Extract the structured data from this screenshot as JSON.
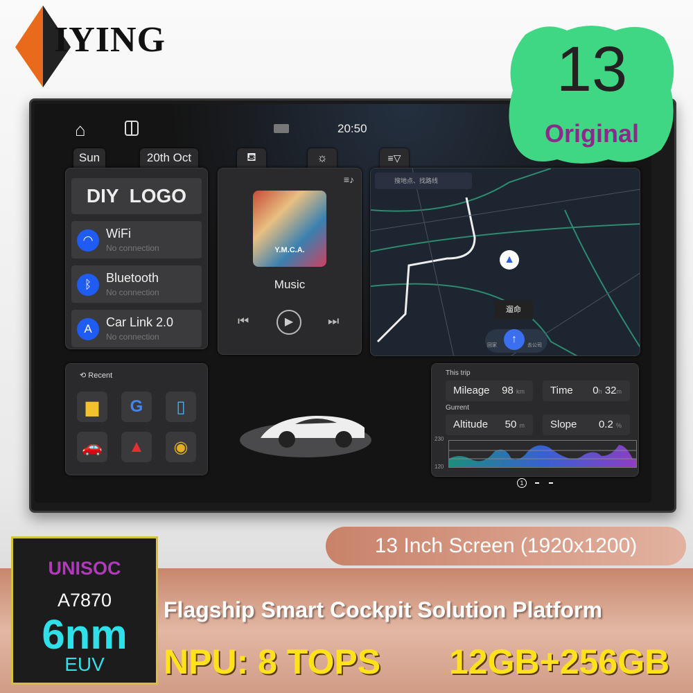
{
  "brand": {
    "name": "IYING",
    "registered": "®"
  },
  "badge": {
    "version": "13",
    "label": "Original",
    "color": "#3fd784"
  },
  "statusbar": {
    "time": "20:50",
    "icons": [
      "home-icon",
      "split-screen-icon",
      "camera-icon"
    ]
  },
  "chips": {
    "day": "Sun",
    "date": "20th Oct",
    "icons": [
      "seat-icon",
      "light-bulb-icon",
      "menu-filter-icon"
    ]
  },
  "connectivity": {
    "logo": "DIY  LOGO",
    "items": [
      {
        "title": "WiFi",
        "status": "No connection",
        "icon": "wifi-icon"
      },
      {
        "title": "Bluetooth",
        "status": "No connection",
        "icon": "bluetooth-icon"
      },
      {
        "title": "Car Link 2.0",
        "status": "No connection",
        "icon": "car-link-icon"
      }
    ]
  },
  "music": {
    "title": "Music",
    "album_text": "Y.M.C.A."
  },
  "map": {
    "search_placeholder": "搜地点、找路线",
    "center_label": "遛命",
    "home": "回家",
    "company": "去公司"
  },
  "recent": {
    "label": "Recent",
    "apps": [
      "files-icon",
      "google-icon",
      "phone-link-icon",
      "car-icon",
      "navigation-icon",
      "chrome-icon"
    ]
  },
  "trip": {
    "this_trip": "This trip",
    "current": "Gurrent",
    "mileage": {
      "label": "Mileage",
      "value": "98",
      "unit": "km"
    },
    "time": {
      "label": "Time",
      "hours": "0",
      "h": "h",
      "minutes": "32",
      "m": "m"
    },
    "altitude": {
      "label": "Altitude",
      "value": "50",
      "unit": "m"
    },
    "slope": {
      "label": "Slope",
      "value": "0.2",
      "unit": "%"
    },
    "chart": {
      "ymax": "230",
      "ymin": "120"
    },
    "page": "1"
  },
  "marketing": {
    "screen": "13 Inch Screen (1920x1200)",
    "platform": "Flagship Smart Cockpit Solution Platform",
    "npu": "NPU: 8 TOPS",
    "memory": "12GB+256GB"
  },
  "chip": {
    "brand": "UNISOC",
    "model": "A7870",
    "process": "6nm",
    "tech": "EUV"
  }
}
